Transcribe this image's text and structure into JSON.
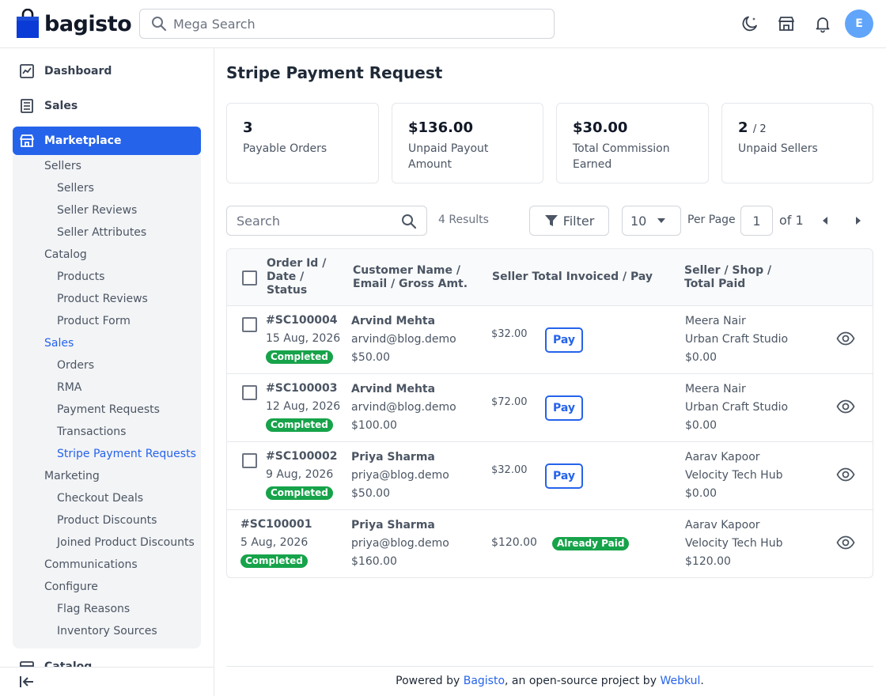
{
  "header": {
    "brand": "bagisto",
    "search_placeholder": "Mega Search",
    "avatar_initial": "E"
  },
  "sidebar": {
    "top_items": [
      {
        "label": "Dashboard",
        "icon": "dashboard-icon"
      },
      {
        "label": "Sales",
        "icon": "sales-icon"
      }
    ],
    "active": {
      "label": "Marketplace",
      "icon": "store-icon"
    },
    "sub_items": [
      {
        "label": "Sellers",
        "level": 1
      },
      {
        "label": "Sellers",
        "level": 2
      },
      {
        "label": "Seller Reviews",
        "level": 2
      },
      {
        "label": "Seller Attributes",
        "level": 2
      },
      {
        "label": "Catalog",
        "level": 1
      },
      {
        "label": "Products",
        "level": 2
      },
      {
        "label": "Product Reviews",
        "level": 2
      },
      {
        "label": "Product Form",
        "level": 2
      },
      {
        "label": "Sales",
        "level": 1,
        "active": true
      },
      {
        "label": "Orders",
        "level": 2
      },
      {
        "label": "RMA",
        "level": 2
      },
      {
        "label": "Payment Requests",
        "level": 2
      },
      {
        "label": "Transactions",
        "level": 2
      },
      {
        "label": "Stripe Payment Requests",
        "level": 2,
        "active": true
      },
      {
        "label": "Marketing",
        "level": 1
      },
      {
        "label": "Checkout Deals",
        "level": 2
      },
      {
        "label": "Product Discounts",
        "level": 2
      },
      {
        "label": "Joined Product Discounts",
        "level": 2
      },
      {
        "label": "Communications",
        "level": 1
      },
      {
        "label": "Configure",
        "level": 1
      },
      {
        "label": "Flag Reasons",
        "level": 2
      },
      {
        "label": "Inventory Sources",
        "level": 2
      }
    ],
    "cut_item": "Catalog"
  },
  "page": {
    "title": "Stripe Payment Request"
  },
  "cards": [
    {
      "value": "3",
      "suffix": "",
      "label": "Payable Orders"
    },
    {
      "value": "$136.00",
      "suffix": "",
      "label": "Unpaid Payout Amount"
    },
    {
      "value": "$30.00",
      "suffix": "",
      "label": "Total Commission Earned"
    },
    {
      "value": "2",
      "suffix": "/ 2",
      "label": "Unpaid Sellers"
    }
  ],
  "toolbar": {
    "search_placeholder": "Search",
    "results": "4 Results",
    "filter_label": "Filter",
    "per_page_value": "10",
    "per_page_label": "Per Page",
    "page": "1",
    "of_pages": "of 1"
  },
  "table": {
    "headers": {
      "order": [
        "Order Id /",
        "Date /",
        "Status"
      ],
      "customer": [
        "Customer Name /",
        "Email / Gross Amt."
      ],
      "seller_total": "Seller Total Invoiced / Pay",
      "seller": [
        "Seller / Shop /",
        "Total Paid"
      ]
    },
    "rows": [
      {
        "order_id": "#SC100004",
        "date": "15 Aug, 2026",
        "status": "Completed",
        "customer": "Arvind Mehta",
        "email": "arvind@blog.demo",
        "gross": "$50.00",
        "invoiced": "$32.00",
        "action": "Pay",
        "seller": "Meera Nair",
        "shop": "Urban Craft Studio",
        "paid": "$0.00"
      },
      {
        "order_id": "#SC100003",
        "date": "12 Aug, 2026",
        "status": "Completed",
        "customer": "Arvind Mehta",
        "email": "arvind@blog.demo",
        "gross": "$100.00",
        "invoiced": "$72.00",
        "action": "Pay",
        "seller": "Meera Nair",
        "shop": "Urban Craft Studio",
        "paid": "$0.00"
      },
      {
        "order_id": "#SC100002",
        "date": "9 Aug, 2026",
        "status": "Completed",
        "customer": "Priya Sharma",
        "email": "priya@blog.demo",
        "gross": "$50.00",
        "invoiced": "$32.00",
        "action": "Pay",
        "seller": "Aarav Kapoor",
        "shop": "Velocity Tech Hub",
        "paid": "$0.00"
      },
      {
        "order_id": "#SC100001",
        "date": "5 Aug, 2026",
        "status": "Completed",
        "customer": "Priya Sharma",
        "email": "priya@blog.demo",
        "gross": "$160.00",
        "invoiced": "$120.00",
        "action": "Already Paid",
        "seller": "Aarav Kapoor",
        "shop": "Velocity Tech Hub",
        "paid": "$120.00"
      }
    ]
  },
  "footer": {
    "prefix": "Powered by ",
    "link1": "Bagisto",
    "middle": ", an open-source project by ",
    "link2": "Webkul",
    "suffix": "."
  },
  "colors": {
    "accent": "#2563eb",
    "success": "#16a34a"
  }
}
